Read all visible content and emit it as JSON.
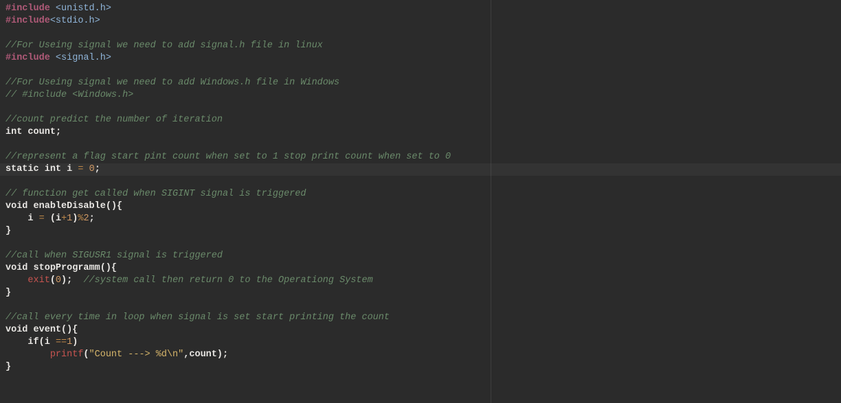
{
  "code": {
    "lines": [
      {
        "tokens": [
          {
            "t": "#include ",
            "c": "tok-include"
          },
          {
            "t": "<unistd.h>",
            "c": "tok-header"
          }
        ]
      },
      {
        "tokens": [
          {
            "t": "#include",
            "c": "tok-include"
          },
          {
            "t": "<stdio.h>",
            "c": "tok-header"
          }
        ]
      },
      {
        "tokens": []
      },
      {
        "tokens": [
          {
            "t": "//For Useing signal we need to add signal.h file in linux",
            "c": "tok-comment"
          }
        ]
      },
      {
        "tokens": [
          {
            "t": "#include ",
            "c": "tok-include"
          },
          {
            "t": "<signal.h>",
            "c": "tok-header"
          }
        ]
      },
      {
        "tokens": []
      },
      {
        "tokens": [
          {
            "t": "//For Useing signal we need to add Windows.h file in Windows",
            "c": "tok-comment"
          }
        ]
      },
      {
        "tokens": [
          {
            "t": "// #include <Windows.h>",
            "c": "tok-comment"
          }
        ]
      },
      {
        "tokens": []
      },
      {
        "tokens": [
          {
            "t": "//count predict the number of iteration",
            "c": "tok-comment"
          }
        ]
      },
      {
        "tokens": [
          {
            "t": "int",
            "c": "tok-keyword"
          },
          {
            "t": " ",
            "c": "tok-plain"
          },
          {
            "t": "count",
            "c": "tok-ident"
          },
          {
            "t": ";",
            "c": "tok-punct"
          }
        ]
      },
      {
        "tokens": []
      },
      {
        "tokens": [
          {
            "t": "//represent a flag start pint count when set to 1 stop print count when set to 0",
            "c": "tok-comment"
          }
        ]
      },
      {
        "tokens": [
          {
            "t": "static",
            "c": "tok-keyword"
          },
          {
            "t": " ",
            "c": "tok-plain"
          },
          {
            "t": "int",
            "c": "tok-keyword"
          },
          {
            "t": " ",
            "c": "tok-plain"
          },
          {
            "t": "i",
            "c": "tok-ident"
          },
          {
            "t": " ",
            "c": "tok-plain"
          },
          {
            "t": "=",
            "c": "tok-op"
          },
          {
            "t": " ",
            "c": "tok-plain"
          },
          {
            "t": "0",
            "c": "tok-num"
          },
          {
            "t": ";",
            "c": "tok-punct"
          }
        ]
      },
      {
        "tokens": []
      },
      {
        "tokens": [
          {
            "t": "// function get called when SIGINT signal is triggered",
            "c": "tok-comment"
          }
        ]
      },
      {
        "tokens": [
          {
            "t": "void",
            "c": "tok-keyword"
          },
          {
            "t": " ",
            "c": "tok-plain"
          },
          {
            "t": "enableDisable",
            "c": "tok-func-decl"
          },
          {
            "t": "(){",
            "c": "tok-punct"
          }
        ]
      },
      {
        "indent": 1,
        "tokens": [
          {
            "t": "    ",
            "c": "tok-plain"
          },
          {
            "t": "i",
            "c": "tok-ident"
          },
          {
            "t": " ",
            "c": "tok-plain"
          },
          {
            "t": "=",
            "c": "tok-op"
          },
          {
            "t": " ",
            "c": "tok-plain"
          },
          {
            "t": "(",
            "c": "tok-punct"
          },
          {
            "t": "i",
            "c": "tok-ident"
          },
          {
            "t": "+",
            "c": "tok-op"
          },
          {
            "t": "1",
            "c": "tok-num"
          },
          {
            "t": ")",
            "c": "tok-punct"
          },
          {
            "t": "%",
            "c": "tok-op"
          },
          {
            "t": "2",
            "c": "tok-num"
          },
          {
            "t": ";",
            "c": "tok-punct"
          }
        ]
      },
      {
        "tokens": [
          {
            "t": "}",
            "c": "tok-punct"
          }
        ]
      },
      {
        "tokens": []
      },
      {
        "tokens": [
          {
            "t": "//call when SIGUSR1 signal is triggered",
            "c": "tok-comment"
          }
        ]
      },
      {
        "tokens": [
          {
            "t": "void",
            "c": "tok-keyword"
          },
          {
            "t": " ",
            "c": "tok-plain"
          },
          {
            "t": "stopProgramm",
            "c": "tok-func-decl"
          },
          {
            "t": "(){",
            "c": "tok-punct"
          }
        ]
      },
      {
        "indent": 1,
        "tokens": [
          {
            "t": "    ",
            "c": "tok-plain"
          },
          {
            "t": "exit",
            "c": "tok-call"
          },
          {
            "t": "(",
            "c": "tok-punct"
          },
          {
            "t": "0",
            "c": "tok-num"
          },
          {
            "t": ")",
            "c": "tok-punct"
          },
          {
            "t": ";",
            "c": "tok-punct"
          },
          {
            "t": "  ",
            "c": "tok-plain"
          },
          {
            "t": "//system call then return 0 to the Operationg System",
            "c": "tok-comment"
          }
        ]
      },
      {
        "tokens": [
          {
            "t": "}",
            "c": "tok-punct"
          }
        ]
      },
      {
        "tokens": []
      },
      {
        "tokens": [
          {
            "t": "//call every time in loop when signal is set start printing the count",
            "c": "tok-comment"
          }
        ]
      },
      {
        "tokens": [
          {
            "t": "void",
            "c": "tok-keyword"
          },
          {
            "t": " ",
            "c": "tok-plain"
          },
          {
            "t": "event",
            "c": "tok-func-decl"
          },
          {
            "t": "(){",
            "c": "tok-punct"
          }
        ]
      },
      {
        "indent": 1,
        "tokens": [
          {
            "t": "    ",
            "c": "tok-plain"
          },
          {
            "t": "if",
            "c": "tok-keyword"
          },
          {
            "t": "(",
            "c": "tok-punct"
          },
          {
            "t": "i",
            "c": "tok-ident"
          },
          {
            "t": " ",
            "c": "tok-plain"
          },
          {
            "t": "==",
            "c": "tok-op"
          },
          {
            "t": "1",
            "c": "tok-num"
          },
          {
            "t": ")",
            "c": "tok-punct"
          }
        ]
      },
      {
        "indent": 2,
        "tokens": [
          {
            "t": "        ",
            "c": "tok-plain"
          },
          {
            "t": "printf",
            "c": "tok-call"
          },
          {
            "t": "(",
            "c": "tok-punct"
          },
          {
            "t": "\"Count ---> %d\\n\"",
            "c": "tok-string"
          },
          {
            "t": ",",
            "c": "tok-punct"
          },
          {
            "t": "count",
            "c": "tok-ident"
          },
          {
            "t": ")",
            "c": "tok-punct"
          },
          {
            "t": ";",
            "c": "tok-punct"
          }
        ]
      },
      {
        "tokens": [
          {
            "t": "}",
            "c": "tok-punct"
          }
        ]
      }
    ]
  },
  "highlight_line_index": 13
}
